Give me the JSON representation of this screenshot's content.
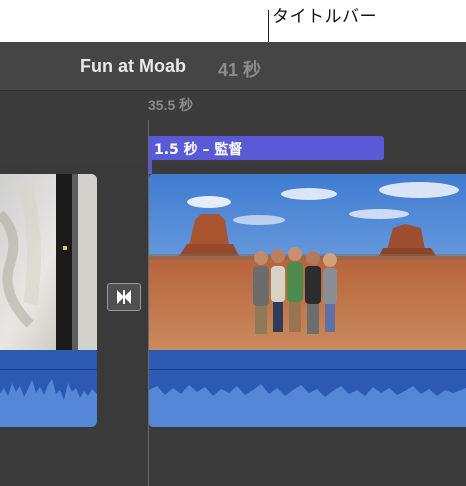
{
  "annotation": {
    "label": "タイトルバー"
  },
  "project": {
    "name": "Fun at Moab",
    "duration": "41 秒"
  },
  "timeline": {
    "time_readout": "35.5 秒",
    "title_bar_label": "1.5 秒 – 監督"
  },
  "icons": {
    "transition": "transition-bowtie-icon"
  },
  "colors": {
    "title_bar": "#5a5ad6",
    "audio_waveform": "#2c5ab3",
    "background": "#3a3a3a"
  }
}
